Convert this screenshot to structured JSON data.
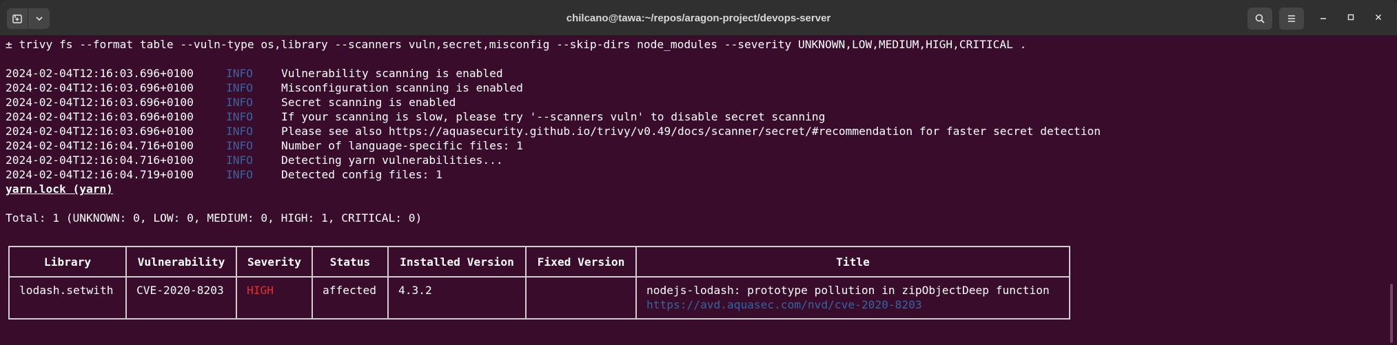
{
  "window": {
    "title": "chilcano@tawa:~/repos/aragon-project/devops-server"
  },
  "terminal": {
    "command": "± trivy fs --format table --vuln-type os,library --scanners vuln,secret,misconfig --skip-dirs node_modules --severity UNKNOWN,LOW,MEDIUM,HIGH,CRITICAL .",
    "logs": [
      {
        "ts": "2024-02-04T12:16:03.696+0100",
        "level": "INFO",
        "msg": "Vulnerability scanning is enabled"
      },
      {
        "ts": "2024-02-04T12:16:03.696+0100",
        "level": "INFO",
        "msg": "Misconfiguration scanning is enabled"
      },
      {
        "ts": "2024-02-04T12:16:03.696+0100",
        "level": "INFO",
        "msg": "Secret scanning is enabled"
      },
      {
        "ts": "2024-02-04T12:16:03.696+0100",
        "level": "INFO",
        "msg": "If your scanning is slow, please try '--scanners vuln' to disable secret scanning"
      },
      {
        "ts": "2024-02-04T12:16:03.696+0100",
        "level": "INFO",
        "msg": "Please see also https://aquasecurity.github.io/trivy/v0.49/docs/scanner/secret/#recommendation for faster secret detection"
      },
      {
        "ts": "2024-02-04T12:16:04.716+0100",
        "level": "INFO",
        "msg": "Number of language-specific files: 1"
      },
      {
        "ts": "2024-02-04T12:16:04.716+0100",
        "level": "INFO",
        "msg": "Detecting yarn vulnerabilities..."
      },
      {
        "ts": "2024-02-04T12:16:04.719+0100",
        "level": "INFO",
        "msg": "Detected config files: 1"
      }
    ],
    "section_title": "yarn.lock (yarn)",
    "total": "Total: 1 (UNKNOWN: 0, LOW: 0, MEDIUM: 0, HIGH: 1, CRITICAL: 0)",
    "table": {
      "headers": [
        "Library",
        "Vulnerability",
        "Severity",
        "Status",
        "Installed Version",
        "Fixed Version",
        "Title"
      ],
      "row": {
        "library": "lodash.setwith",
        "vulnerability": "CVE-2020-8203",
        "severity": "HIGH",
        "status": "affected",
        "installed_version": "4.3.2",
        "fixed_version": "",
        "title": "nodejs-lodash: prototype pollution in zipObjectDeep function",
        "link": "https://avd.aquasec.com/nvd/cve-2020-8203"
      }
    }
  },
  "colors": {
    "terminal_bg": "#380c2a",
    "info": "#3465a4",
    "high": "#ef2929",
    "link": "#3465a4"
  },
  "icons": [
    "new-tab-icon",
    "chevron-down-icon",
    "search-icon",
    "hamburger-menu-icon",
    "minimize-icon",
    "maximize-icon",
    "close-icon"
  ]
}
